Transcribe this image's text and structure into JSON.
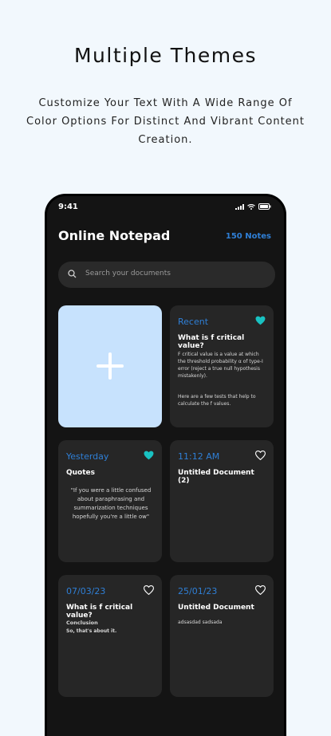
{
  "promo": {
    "title": "Multiple Themes",
    "subtitle": "Customize Your Text With A Wide Range Of Color Options For Distinct And Vibrant Content Creation."
  },
  "status": {
    "time": "9:41"
  },
  "header": {
    "title": "Online Notepad",
    "count": "150 Notes"
  },
  "search": {
    "placeholder": "Search your documents"
  },
  "colors": {
    "accent": "#2f7fd6",
    "favorite": "#19c2c2",
    "card": "#262626",
    "add_card": "#c7e2fd"
  },
  "notes": [
    {
      "date": "Recent",
      "favorite": true,
      "title": "What is f critical value?",
      "body1": "F critical value is a value at which the threshold probability α of type-I error (reject a true null hypothesis mistakenly).",
      "body2": "Here are a few tests that help to calculate the f values."
    },
    {
      "date": "Yesterday",
      "favorite": true,
      "title": "Quotes",
      "body1": "\"If you were a little confused about paraphrasing and summarization techniques hopefully you're a little ow\""
    },
    {
      "date": "11:12 AM",
      "favorite": false,
      "title": "Untitled Document (2)"
    },
    {
      "date": "07/03/23",
      "favorite": false,
      "title": "What is f critical value?",
      "body1": "Conclusion",
      "body2": "So, that's about it."
    },
    {
      "date": "25/01/23",
      "favorite": false,
      "title": "Untitled Document",
      "body1": "adsasdad sadsada"
    }
  ]
}
